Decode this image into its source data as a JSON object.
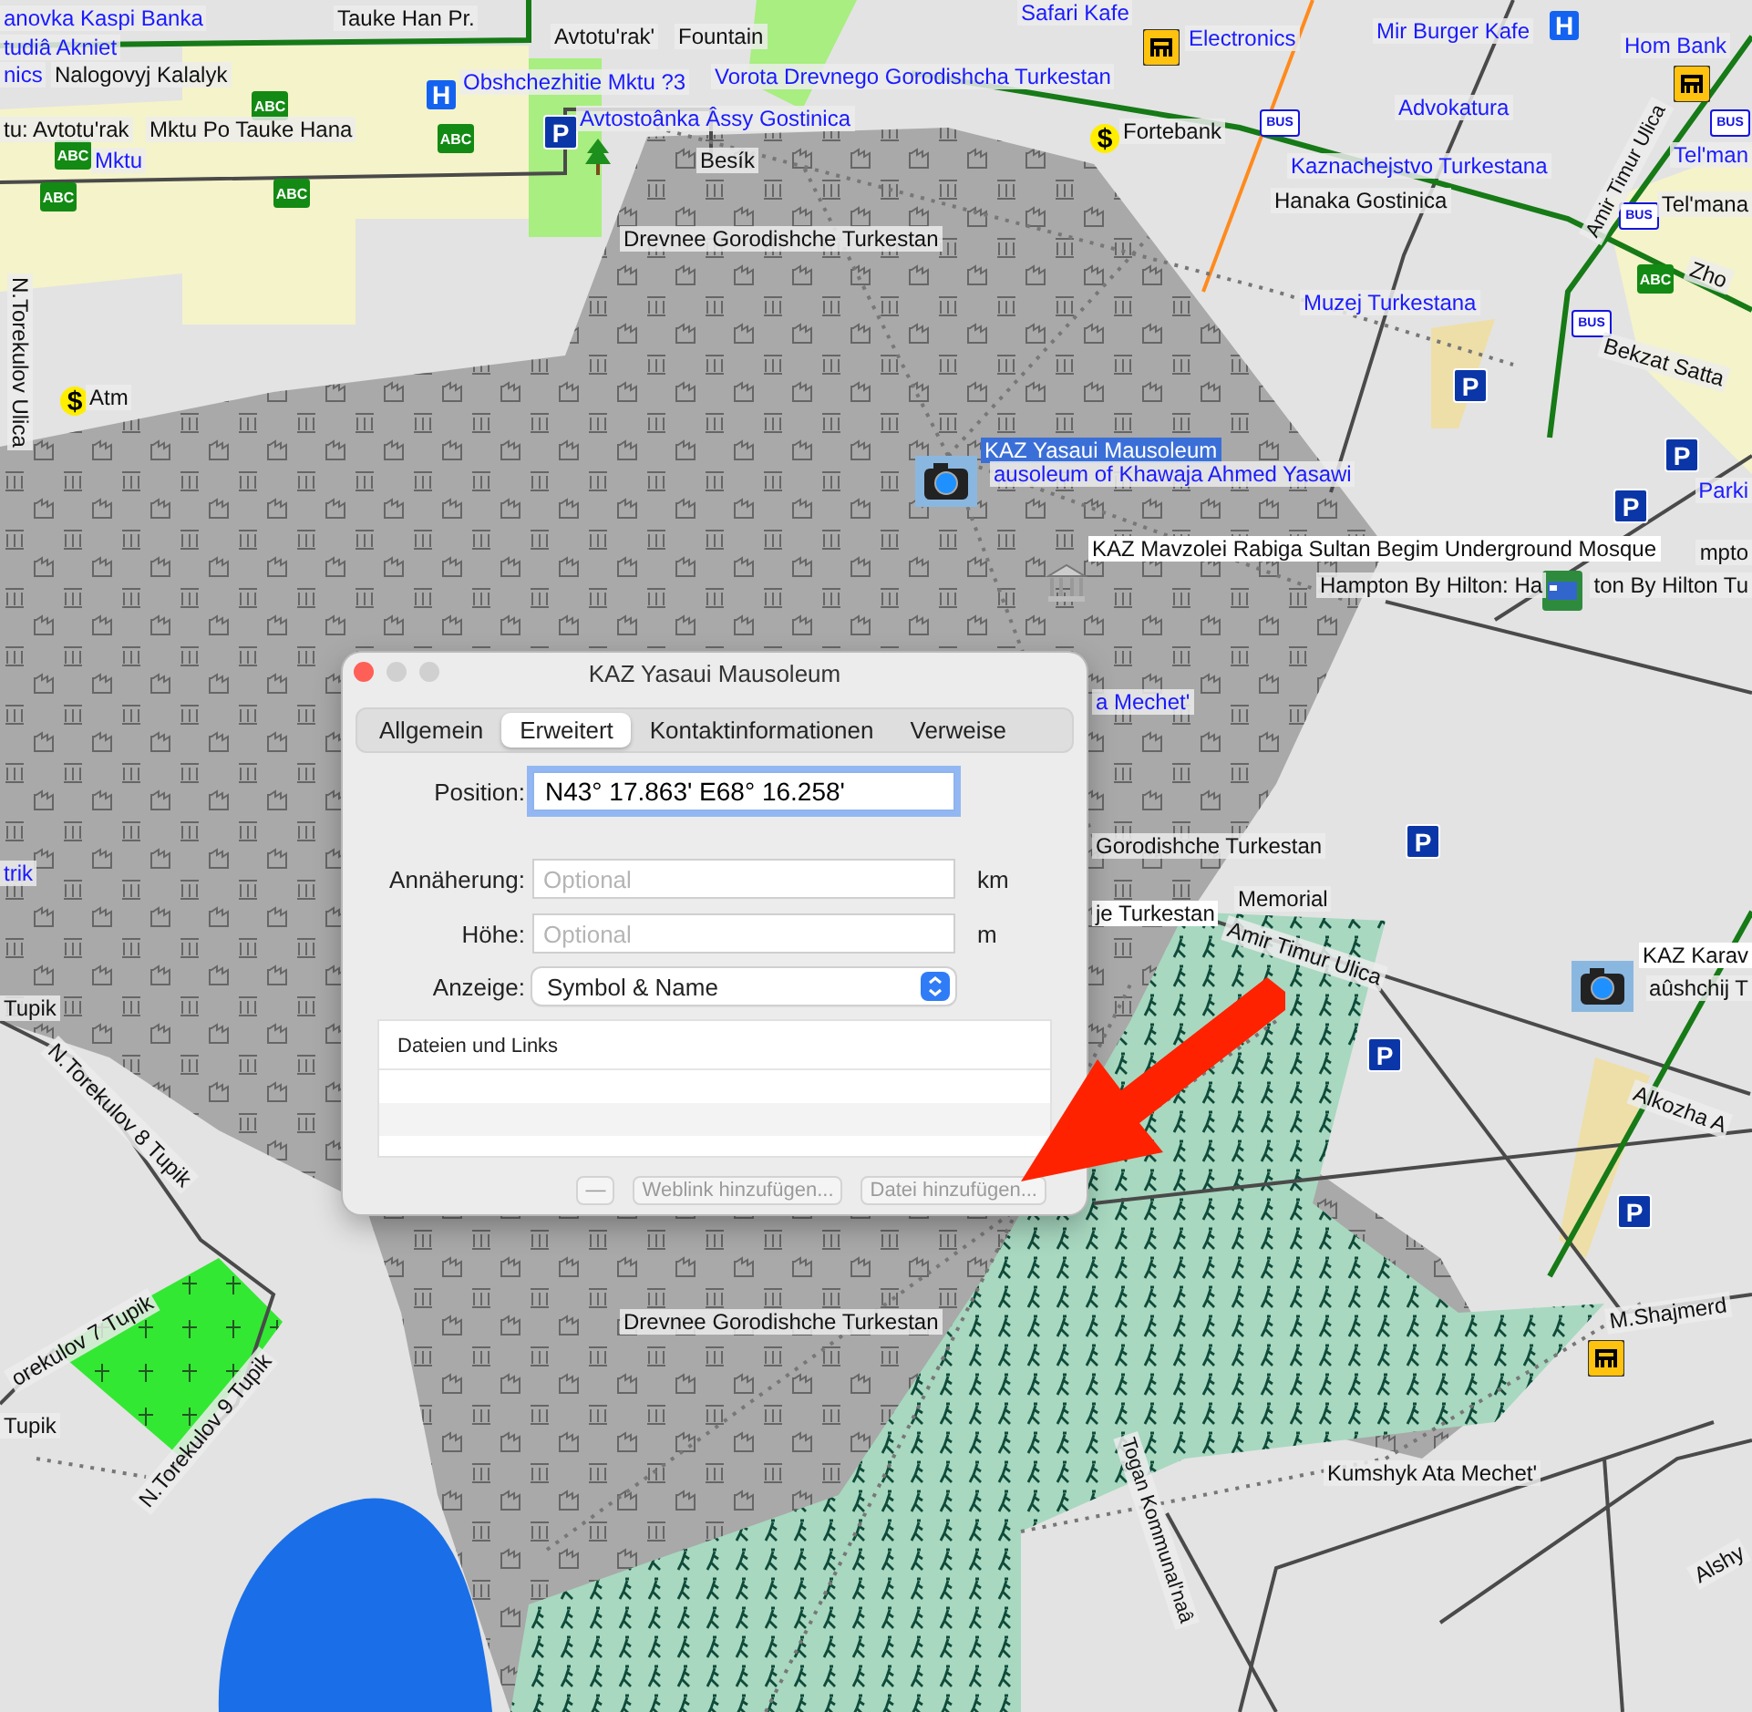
{
  "map": {
    "labels": [
      {
        "text": "anovka Kaspi Banka",
        "kind": "poi"
      },
      {
        "text": "tudiâ Akniet",
        "kind": "poi"
      },
      {
        "text": "nics",
        "kind": "poi"
      },
      {
        "text": "Nalogovyj Kalalyk",
        "kind": "place"
      },
      {
        "text": "tu: Avtotu'rak",
        "kind": "place"
      },
      {
        "text": "Mktu Po Tauke Hana",
        "kind": "place"
      },
      {
        "text": "Mktu",
        "kind": "poi"
      },
      {
        "text": "Tauke Han Pr.",
        "kind": "place"
      },
      {
        "text": "Avtotu'rak'",
        "kind": "place"
      },
      {
        "text": "Fountain",
        "kind": "place"
      },
      {
        "text": "Obshchezhitie Mktu ?3",
        "kind": "poi"
      },
      {
        "text": "Vorota Drevnego Gorodishcha Turkestan",
        "kind": "poi"
      },
      {
        "text": "Avtostoânka Âssy Gostinica",
        "kind": "poi"
      },
      {
        "text": "Besík",
        "kind": "place"
      },
      {
        "text": "Drevnee Gorodishche Turkestan",
        "kind": "place"
      },
      {
        "text": "N.Torekulov Ulica",
        "kind": "street"
      },
      {
        "text": "Atm",
        "kind": "place"
      },
      {
        "text": "Safari Kafe",
        "kind": "poi"
      },
      {
        "text": "Electronics",
        "kind": "poi"
      },
      {
        "text": "Mir Burger Kafe",
        "kind": "poi"
      },
      {
        "text": "Fortebank",
        "kind": "place"
      },
      {
        "text": "Advokatura",
        "kind": "poi"
      },
      {
        "text": "Kaznachejstvo Turkestana",
        "kind": "poi"
      },
      {
        "text": "Hanaka Gostinica",
        "kind": "place"
      },
      {
        "text": "Muzej Turkestana",
        "kind": "poi"
      },
      {
        "text": "Hom Bank",
        "kind": "poi"
      },
      {
        "text": "Tel'man",
        "kind": "poi"
      },
      {
        "text": "Tel'mana",
        "kind": "place"
      },
      {
        "text": "Zho",
        "kind": "place"
      },
      {
        "text": "Bekzat Satta",
        "kind": "street"
      },
      {
        "text": "Amir Timur Ulica",
        "kind": "street"
      },
      {
        "text": "KAZ Yasaui Mausoleum",
        "kind": "highlighted"
      },
      {
        "text": "ausoleum of Khawaja Ahmed Yasawi",
        "kind": "poi"
      },
      {
        "text": "Parki",
        "kind": "poi"
      },
      {
        "text": "KAZ Mavzolei Rabiga Sultan Begim Underground Mosque",
        "kind": "boxed"
      },
      {
        "text": "mpto",
        "kind": "place"
      },
      {
        "text": "Hampton By Hilton: Ha",
        "kind": "place"
      },
      {
        "text": "ton By Hilton Tu",
        "kind": "place"
      },
      {
        "text": "Gorodishche Turkestan",
        "kind": "place"
      },
      {
        "text": "je Turkestan",
        "kind": "boxed"
      },
      {
        "text": "Memorial",
        "kind": "place"
      },
      {
        "text": "Amir Timur Ulica",
        "kind": "street"
      },
      {
        "text": "KAZ Karav",
        "kind": "boxed"
      },
      {
        "text": "aûshchij T",
        "kind": "place"
      },
      {
        "text": "Alkozha A",
        "kind": "street"
      },
      {
        "text": "M.Shajmerd",
        "kind": "street"
      },
      {
        "text": "Drevnee Gorodishche Turkestan",
        "kind": "place"
      },
      {
        "text": "Kumshyk Ata Mechet'",
        "kind": "place"
      },
      {
        "text": "Alshy",
        "kind": "street"
      },
      {
        "text": "Togan Kommunal'naâ",
        "kind": "street"
      },
      {
        "text": "trik",
        "kind": "poi"
      },
      {
        "text": "Tupik",
        "kind": "street"
      },
      {
        "text": "N.Torekulov 8 Tupik",
        "kind": "street"
      },
      {
        "text": "orekulov 7 Tupik",
        "kind": "street"
      },
      {
        "text": "Tupik",
        "kind": "street"
      },
      {
        "text": "N.Torekulov 9 Tupik",
        "kind": "street"
      },
      {
        "text": "a Mechet'",
        "kind": "poi"
      }
    ],
    "badges": [
      {
        "kind": "school",
        "text": "ABC"
      },
      {
        "kind": "school",
        "text": "ABC"
      },
      {
        "kind": "school",
        "text": "ABC"
      },
      {
        "kind": "school",
        "text": "ABC"
      },
      {
        "kind": "school",
        "text": "ABC"
      },
      {
        "kind": "school",
        "text": "ABC"
      },
      {
        "kind": "parking",
        "text": "P"
      },
      {
        "kind": "parking",
        "text": "P"
      },
      {
        "kind": "parking",
        "text": "P"
      },
      {
        "kind": "parking",
        "text": "P"
      },
      {
        "kind": "parking",
        "text": "P"
      },
      {
        "kind": "parking",
        "text": "P"
      },
      {
        "kind": "parking",
        "text": "P"
      },
      {
        "kind": "hospital",
        "text": "H"
      },
      {
        "kind": "hospital",
        "text": "H"
      },
      {
        "kind": "bus",
        "text": "BUS"
      },
      {
        "kind": "bus",
        "text": "BUS"
      },
      {
        "kind": "bus",
        "text": "BUS"
      },
      {
        "kind": "bus",
        "text": "BUS"
      },
      {
        "kind": "bank",
        "text": "$"
      },
      {
        "kind": "bank",
        "text": "$"
      }
    ]
  },
  "dialog": {
    "title": "KAZ Yasaui Mausoleum",
    "tabs": [
      {
        "label": "Allgemein",
        "selected": false
      },
      {
        "label": "Erweitert",
        "selected": true
      },
      {
        "label": "Kontaktinformationen",
        "selected": false
      },
      {
        "label": "Verweise",
        "selected": false
      }
    ],
    "position": {
      "label": "Position:",
      "value": "N43° 17.863' E68° 16.258'"
    },
    "fields": [
      {
        "label": "Annäherung:",
        "placeholder": "Optional",
        "unit": "km"
      },
      {
        "label": "Höhe:",
        "placeholder": "Optional",
        "unit": "m"
      }
    ],
    "display": {
      "label": "Anzeige:",
      "value": "Symbol & Name"
    },
    "table": {
      "header": "Dateien und Links"
    },
    "buttons": [
      {
        "label": "—",
        "disabled": true
      },
      {
        "label": "Weblink hinzufügen...",
        "disabled": true
      },
      {
        "label": "Datei hinzufügen...",
        "disabled": true
      }
    ]
  }
}
